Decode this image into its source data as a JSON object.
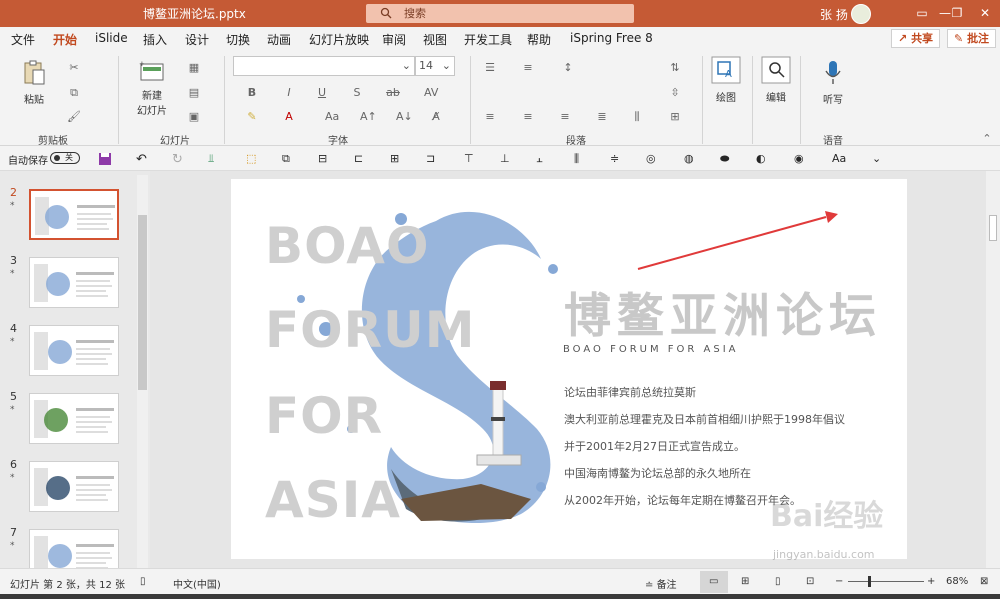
{
  "titlebar": {
    "document": "博鳌亚洲论坛.pptx",
    "search_placeholder": "搜索",
    "user": "张 扬",
    "minimize": "—",
    "restore": "❐",
    "close": "✕"
  },
  "menu": {
    "tabs": [
      "文件",
      "开始",
      "iSlide",
      "插入",
      "设计",
      "切换",
      "动画",
      "幻灯片放映",
      "审阅",
      "视图",
      "开发工具",
      "帮助",
      "iSpring Free 8"
    ],
    "active": "开始",
    "share": "共享",
    "comment": "批注"
  },
  "ribbon": {
    "paste": "粘贴",
    "new_slide": "新建\n幻灯片",
    "font_size": "14",
    "drawing": "绘图",
    "editing": "编辑",
    "dictate": "听写",
    "groups": {
      "clipboard": "剪贴板",
      "slides": "幻灯片",
      "font": "字体",
      "paragraph": "段落",
      "voice": "语音"
    }
  },
  "qat": {
    "autosave": "自动保存",
    "autosave_state": "关"
  },
  "thumbnails": [
    {
      "num": "2",
      "star": "*",
      "selected": true
    },
    {
      "num": "3",
      "star": "*",
      "selected": false
    },
    {
      "num": "4",
      "star": "*",
      "selected": false
    },
    {
      "num": "5",
      "star": "*",
      "selected": false
    },
    {
      "num": "6",
      "star": "*",
      "selected": false
    },
    {
      "num": "7",
      "star": "*",
      "selected": false
    }
  ],
  "slide": {
    "words": [
      "BOAO",
      "FORUM",
      "FOR",
      "ASIA"
    ],
    "title": "博鳌亚洲论坛",
    "subtitle": "BOAO FORUM FOR ASIA",
    "lines": [
      "论坛由菲律宾前总统拉莫斯",
      "澳大利亚前总理霍克及日本前首相细川护熙于1998年倡议",
      "并于2001年2月27日正式宣告成立。",
      "中国海南博鳌为论坛总部的永久地所在",
      "从2002年开始，论坛每年定期在博鳌召开年会。"
    ]
  },
  "status": {
    "slide_info": "幻灯片 第 2 张，共 12 张",
    "language": "中文(中国)",
    "notes": "备注",
    "zoom": "68%",
    "zoom_minus": "−",
    "zoom_plus": "+"
  },
  "watermark": {
    "text": "Bai经验",
    "url": "jingyan.baidu.com"
  },
  "colors": {
    "accent": "#c55a35",
    "active_tab": "#c1491f",
    "arrow": "#e03a3a",
    "splash": "#86a8d6"
  }
}
